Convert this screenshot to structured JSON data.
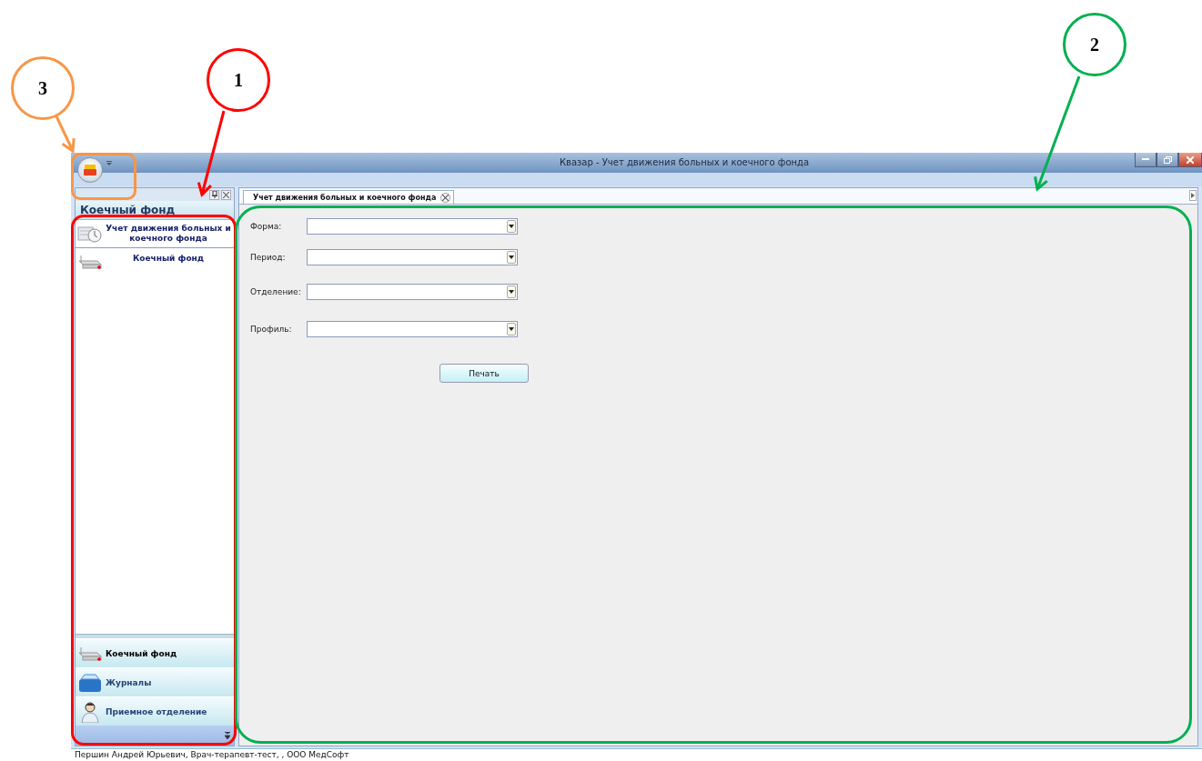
{
  "callouts": [
    {
      "label": "3",
      "color": "#f79646"
    },
    {
      "label": "1",
      "color": "#ff0000"
    },
    {
      "label": "2",
      "color": "#00b050"
    }
  ],
  "window": {
    "title": "Квазар - Учет движения больных и коечного фонда"
  },
  "nav_panel": {
    "title": "Коечный фонд",
    "items": [
      {
        "label": "Учет движения больных и коечного фонда",
        "selected": true
      },
      {
        "label": "Коечный фонд",
        "selected": false
      }
    ],
    "groups": [
      {
        "label": "Коечный фонд",
        "selected": true
      },
      {
        "label": "Журналы",
        "selected": false
      },
      {
        "label": "Приемное отделение",
        "selected": false
      }
    ]
  },
  "tabs": [
    {
      "label": "Учет движения больных и коечного фонда",
      "selected": true
    }
  ],
  "form": {
    "fields": [
      {
        "label": "Форма:"
      },
      {
        "label": "Период:"
      },
      {
        "label": "Отделение:"
      },
      {
        "label": "Профиль:"
      }
    ],
    "button": "Печать"
  },
  "status_bar": "Першин Андрей Юрьевич, Врач-терапевт-тест, , ООО МедСофт"
}
